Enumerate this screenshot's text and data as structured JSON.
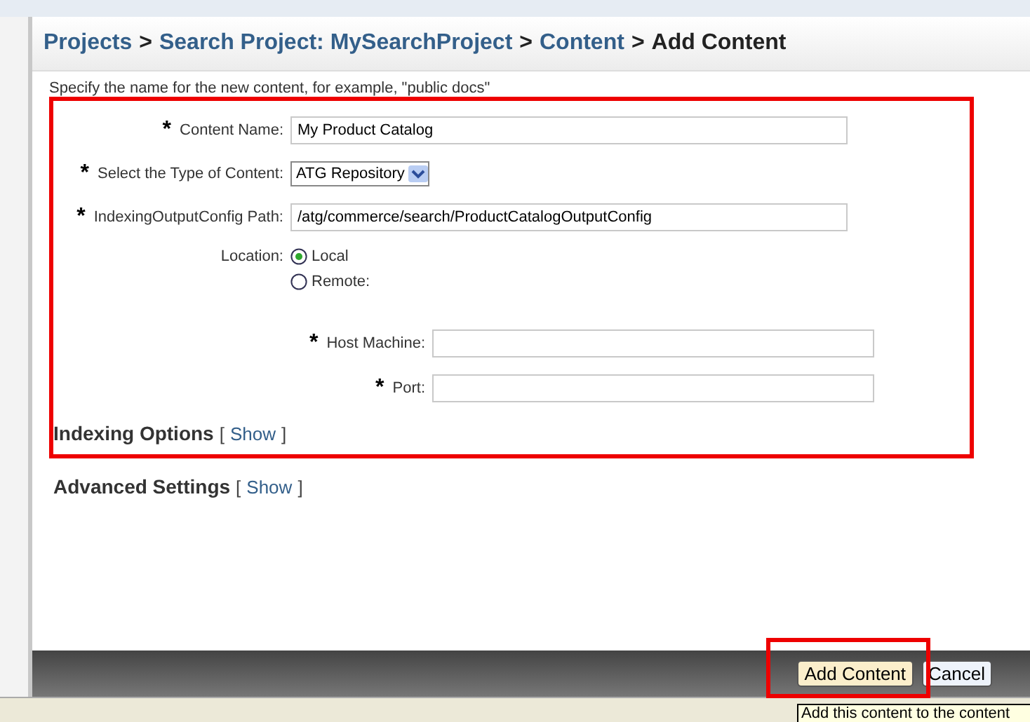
{
  "breadcrumb": [
    {
      "label": "Projects",
      "link": true
    },
    {
      "label": "Search Project: MySearchProject",
      "link": true
    },
    {
      "label": "Content",
      "link": true
    },
    {
      "label": "Add Content",
      "link": false
    }
  ],
  "separator": ">",
  "instructions": "Specify the name for the new content, for example, \"public docs\"",
  "fields": [
    {
      "kind": "text",
      "mark": "*",
      "label": "Content Name:",
      "value": "My Product Catalog"
    },
    {
      "kind": "select",
      "mark": "*",
      "label": "Select the Type of Content:",
      "value": "ATG Repository"
    },
    {
      "kind": "text",
      "mark": "*",
      "label": "IndexingOutputConfig Path:",
      "value": "/atg/commerce/search/ProductCatalogOutputConfig"
    },
    {
      "kind": "radio",
      "label": "Location:",
      "options": [
        {
          "label": "Local",
          "selected": true
        },
        {
          "label": "Remote:",
          "selected": false,
          "fields": [
            {
              "mark": "*",
              "label": "Host Machine:"
            },
            {
              "mark": "*",
              "label": "Port:"
            }
          ]
        }
      ]
    }
  ],
  "sections": [
    {
      "title": "Indexing Options",
      "open": "[",
      "action": "Show",
      "close": "]"
    },
    {
      "title": "Advanced Settings",
      "open": "[",
      "action": "Show",
      "close": "]"
    }
  ],
  "buttons": [
    {
      "kind": "primary",
      "label": "Add Content"
    },
    {
      "kind": "secondary",
      "label": "Cancel"
    }
  ],
  "tooltip": "Add this content to the content"
}
